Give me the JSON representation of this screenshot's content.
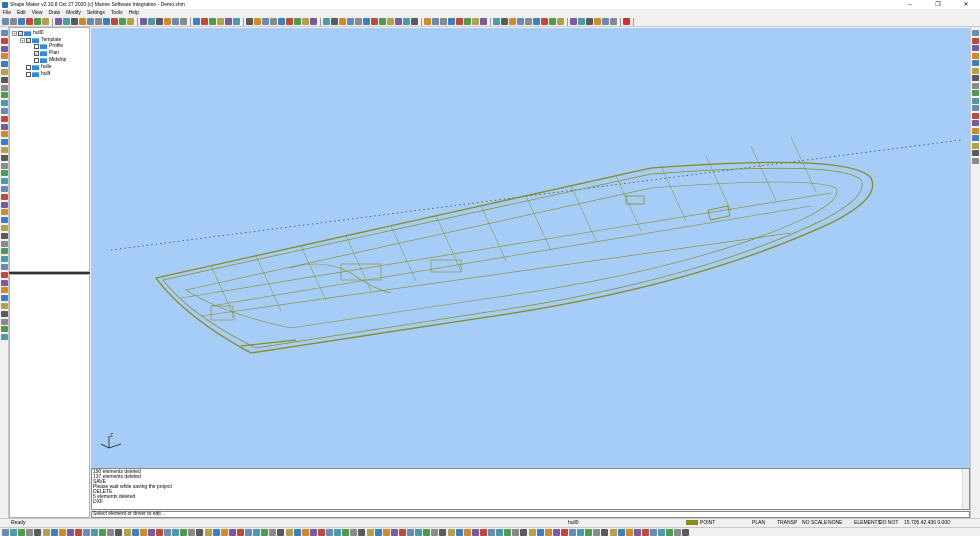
{
  "window": {
    "title": "Shape Maker v2.10.8 Oct 27 2020 (c) Marine Software Integration - Demo.shm",
    "minimize_glyph": "–",
    "maximize_glyph": "❐",
    "close_glyph": "✕"
  },
  "menu": [
    "File",
    "Edit",
    "View",
    "Draw",
    "Modify",
    "Settings",
    "Tools",
    "Help"
  ],
  "tree": {
    "root": "hull0",
    "template": "Template",
    "children": [
      "Profile",
      "Plan",
      "Midship"
    ],
    "extra": [
      "hulle",
      "hullf"
    ],
    "expand_glyph": "+",
    "check_glyph": "✓"
  },
  "console": {
    "lines": [
      "190 elements deleted",
      "137 elements deleted",
      "SAVE",
      "Please wait while saving the project",
      "DELETE",
      "5 elements deleted",
      "DXF"
    ]
  },
  "prompt": "Select element or driver to edit ..",
  "status": {
    "ready": "Ready",
    "hull": "hull0",
    "snap": "POINT",
    "view": "PLAN",
    "transp": "TRANSP",
    "scale": "NO SCALE",
    "none": "NONE",
    "elements": "ELEMENTS",
    "donot": "DO NOT",
    "coords": "15.705 42.436 0.000"
  },
  "viewport": {
    "background": "#a6cdf8",
    "line_color": "#8a8a1e",
    "axis_label": "Z"
  }
}
